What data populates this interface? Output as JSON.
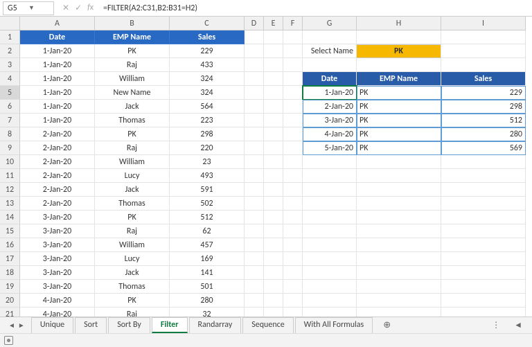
{
  "namebox": "G5",
  "formula": "=FILTER(A2:C31,B2:B31=H2)",
  "cols": [
    "A",
    "B",
    "C",
    "D",
    "E",
    "F",
    "G",
    "H",
    "I"
  ],
  "rownums": [
    1,
    2,
    3,
    4,
    5,
    6,
    7,
    8,
    9,
    10,
    11,
    12,
    13,
    14,
    15,
    16,
    17,
    18,
    19,
    20,
    21
  ],
  "mainHeaders": {
    "date": "Date",
    "emp": "EMP Name",
    "sales": "Sales"
  },
  "mainRows": [
    {
      "d": "1-Jan-20",
      "e": "PK",
      "s": "229"
    },
    {
      "d": "1-Jan-20",
      "e": "Raj",
      "s": "433"
    },
    {
      "d": "1-Jan-20",
      "e": "William",
      "s": "324"
    },
    {
      "d": "1-Jan-20",
      "e": "New Name",
      "s": "324"
    },
    {
      "d": "1-Jan-20",
      "e": "Jack",
      "s": "564"
    },
    {
      "d": "1-Jan-20",
      "e": "Thomas",
      "s": "223"
    },
    {
      "d": "2-Jan-20",
      "e": "PK",
      "s": "298"
    },
    {
      "d": "2-Jan-20",
      "e": "Raj",
      "s": "220"
    },
    {
      "d": "2-Jan-20",
      "e": "William",
      "s": "23"
    },
    {
      "d": "2-Jan-20",
      "e": "Lucy",
      "s": "493"
    },
    {
      "d": "2-Jan-20",
      "e": "Jack",
      "s": "591"
    },
    {
      "d": "2-Jan-20",
      "e": "Thomas",
      "s": "502"
    },
    {
      "d": "3-Jan-20",
      "e": "PK",
      "s": "512"
    },
    {
      "d": "3-Jan-20",
      "e": "Raj",
      "s": "62"
    },
    {
      "d": "3-Jan-20",
      "e": "William",
      "s": "457"
    },
    {
      "d": "3-Jan-20",
      "e": "Lucy",
      "s": "169"
    },
    {
      "d": "3-Jan-20",
      "e": "Jack",
      "s": "141"
    },
    {
      "d": "3-Jan-20",
      "e": "Thomas",
      "s": "501"
    },
    {
      "d": "4-Jan-20",
      "e": "PK",
      "s": "280"
    },
    {
      "d": "4-Jan-20",
      "e": "Raj",
      "s": "32"
    }
  ],
  "selectLabel": "Select Name",
  "selectValue": "PK",
  "filterHeaders": {
    "date": "Date",
    "emp": "EMP Name",
    "sales": "Sales"
  },
  "filterRows": [
    {
      "d": "1-Jan-20",
      "e": "PK",
      "s": "229"
    },
    {
      "d": "2-Jan-20",
      "e": "PK",
      "s": "298"
    },
    {
      "d": "3-Jan-20",
      "e": "PK",
      "s": "512"
    },
    {
      "d": "4-Jan-20",
      "e": "PK",
      "s": "280"
    },
    {
      "d": "5-Jan-20",
      "e": "PK",
      "s": "569"
    }
  ],
  "tabs": [
    "Unique",
    "Sort",
    "Sort By",
    "Filter",
    "Randarray",
    "Sequence",
    "With All Formulas"
  ],
  "activeTab": "Filter"
}
